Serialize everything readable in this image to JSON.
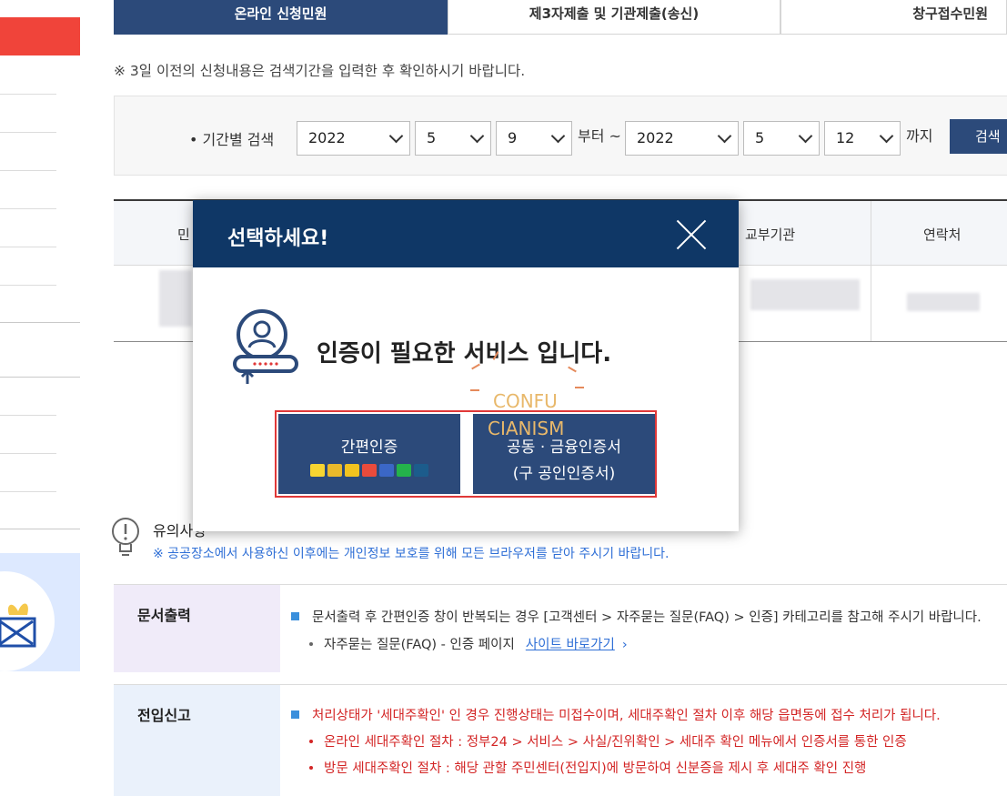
{
  "tabs": [
    {
      "label": "온라인 신청민원",
      "active": true
    },
    {
      "label": "제3자제출 및 기관제출(송신)",
      "active": false
    },
    {
      "label": "창구접수민원",
      "active": false
    }
  ],
  "notice": "※ 3일 이전의 신청내용은 검색기간을 입력한 후 확인하시기 바랍니다.",
  "search": {
    "label": "• 기간별 검색",
    "from_year": "2022",
    "from_month": "5",
    "from_day": "9",
    "from_word": "부터 ~",
    "to_year": "2022",
    "to_month": "5",
    "to_day": "12",
    "to_word": "까지",
    "button": "검색"
  },
  "table": {
    "headers": [
      "민",
      "교부기관",
      "연락처"
    ]
  },
  "modal": {
    "title": "선택하세요!",
    "message": "인증이 필요한 서비스 입니다.",
    "simple_auth": "간편인증",
    "cert_auth_line1": "공동 · 금융인증서",
    "cert_auth_line2": "(구 공인인증서)",
    "watermark_line1": "CONFU",
    "watermark_line2": "CIANISM"
  },
  "caution": {
    "title": "유의사항",
    "text": "※ 공공장소에서 사용하신 이후에는 개인정보 보호를 위해 모든 브라우저를 닫아 주시기 바랍니다."
  },
  "info": [
    {
      "head": "문서출력",
      "line1": "문서출력 후 간편인증 창이 반복되는 경우 [고객센터 > 자주묻는 질문(FAQ) > 인증] 카테고리를 참고해 주시기 바랍니다.",
      "line2": "자주묻는 질문(FAQ) - 인증 페이지",
      "link": "사이트 바로가기",
      "link_arrow": "›"
    },
    {
      "head": "전입신고",
      "line1": "처리상태가 '세대주확인' 인 경우 진행상태는 미접수이며, 세대주확인 절차 이후 해당 읍면동에 접수 처리가 됩니다.",
      "line2": "온라인 세대주확인 절차 : 정부24 > 서비스 > 사실/진위확인 > 세대주 확인 메뉴에서 인증서를 통한 인증",
      "line3": "방문 세대주확인 절차 : 해당 관할 주민센터(전입지)에 방문하여 신분증을 제시 후 세대주 확인 진행"
    }
  ],
  "colors": {
    "navy": "#0f3766",
    "blue": "#2c4a7a",
    "red": "#e03838",
    "link": "#2f6fd6"
  }
}
